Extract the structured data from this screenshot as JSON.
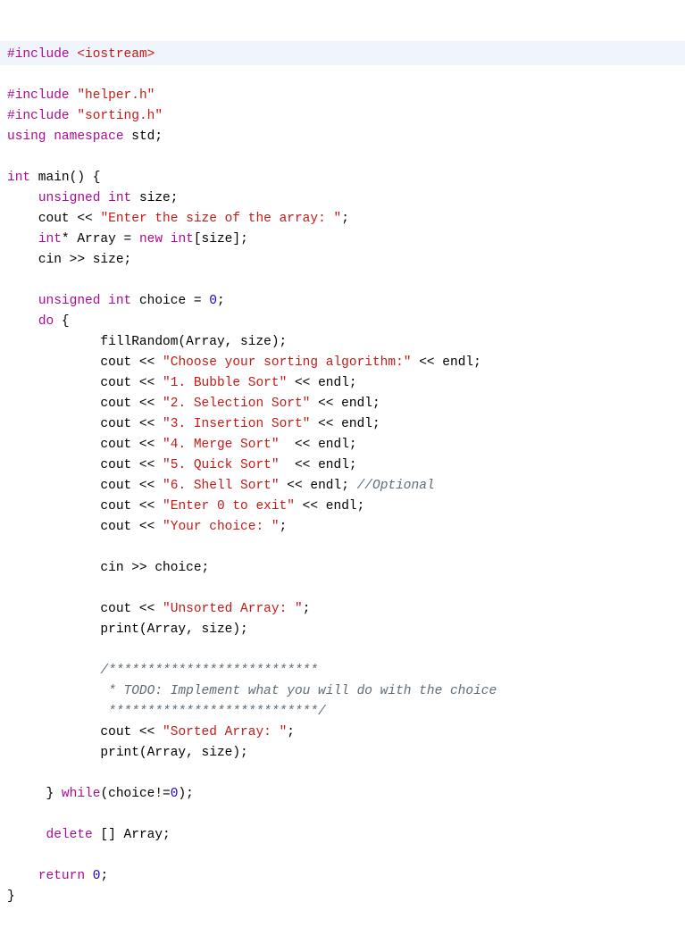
{
  "l1": {
    "pp": "#include",
    "arg": "<iostream>"
  },
  "l2": {
    "pp": "#include",
    "arg": "\"helper.h\""
  },
  "l3": {
    "pp": "#include",
    "arg": "\"sorting.h\""
  },
  "l4": {
    "kw1": "using",
    "kw2": "namespace",
    "id": " std;"
  },
  "l5": {
    "kw": "int",
    "rest": " main() {"
  },
  "l6": {
    "indent": "    ",
    "kw1": "unsigned",
    "kw2": " int",
    "rest": " size;"
  },
  "l7": {
    "indent": "    ",
    "pre": "cout << ",
    "str": "\"Enter the size of the array: \"",
    "post": ";"
  },
  "l8": {
    "indent": "    ",
    "kw1": "int",
    "post1": "* Array = ",
    "kw2": "new",
    "sp": " ",
    "kw3": "int",
    "post2": "[size];"
  },
  "l9": {
    "indent": "    ",
    "txt": "cin >> size;"
  },
  "l10": {
    "indent": "    ",
    "kw1": "unsigned",
    "kw2": " int",
    "mid": " choice = ",
    "num": "0",
    "post": ";"
  },
  "l11": {
    "indent": "    ",
    "kw": "do",
    "post": " {"
  },
  "l12": {
    "indent": "            ",
    "txt": "fillRandom(Array, size);"
  },
  "l13": {
    "indent": "            ",
    "pre": "cout << ",
    "str": "\"Choose your sorting algorithm:\"",
    "post": " << endl;"
  },
  "l14": {
    "indent": "            ",
    "pre": "cout << ",
    "str": "\"1. Bubble Sort\"",
    "post": " << endl;"
  },
  "l15": {
    "indent": "            ",
    "pre": "cout << ",
    "str": "\"2. Selection Sort\"",
    "post": " << endl;"
  },
  "l16": {
    "indent": "            ",
    "pre": "cout << ",
    "str": "\"3. Insertion Sort\"",
    "post": " << endl;"
  },
  "l17": {
    "indent": "            ",
    "pre": "cout << ",
    "str": "\"4. Merge Sort\"",
    "post": "  << endl;"
  },
  "l18": {
    "indent": "            ",
    "pre": "cout << ",
    "str": "\"5. Quick Sort\"",
    "post": "  << endl;"
  },
  "l19": {
    "indent": "            ",
    "pre": "cout << ",
    "str": "\"6. Shell Sort\"",
    "post": " << endl; ",
    "cmt": "//Optional"
  },
  "l20": {
    "indent": "            ",
    "pre": "cout << ",
    "str": "\"Enter 0 to exit\"",
    "post": " << endl;"
  },
  "l21": {
    "indent": "            ",
    "pre": "cout << ",
    "str": "\"Your choice: \"",
    "post": ";"
  },
  "l22": {
    "indent": "            ",
    "txt": "cin >> choice;"
  },
  "l23": {
    "indent": "            ",
    "pre": "cout << ",
    "str": "\"Unsorted Array: \"",
    "post": ";"
  },
  "l24": {
    "indent": "            ",
    "txt": "print(Array, size);"
  },
  "l25": {
    "indent": "            ",
    "cmt": "/***************************"
  },
  "l26": {
    "indent": "            ",
    "cmt": " * TODO: Implement what you will do with the choice"
  },
  "l27": {
    "indent": "            ",
    "cmt": " ***************************/"
  },
  "l28": {
    "indent": "            ",
    "pre": "cout << ",
    "str": "\"Sorted Array: \"",
    "post": ";"
  },
  "l29": {
    "indent": "            ",
    "txt": "print(Array, size);"
  },
  "l30": {
    "indent": "     ",
    "pre": "} ",
    "kw": "while",
    "mid": "(choice!=",
    "num": "0",
    "post": ");"
  },
  "l31": {
    "indent": "     ",
    "kw": "delete",
    "post": " [] Array;"
  },
  "l32": {
    "indent": "    ",
    "kw": "return",
    "sp": " ",
    "num": "0",
    "post": ";"
  },
  "l33": {
    "txt": "}"
  }
}
